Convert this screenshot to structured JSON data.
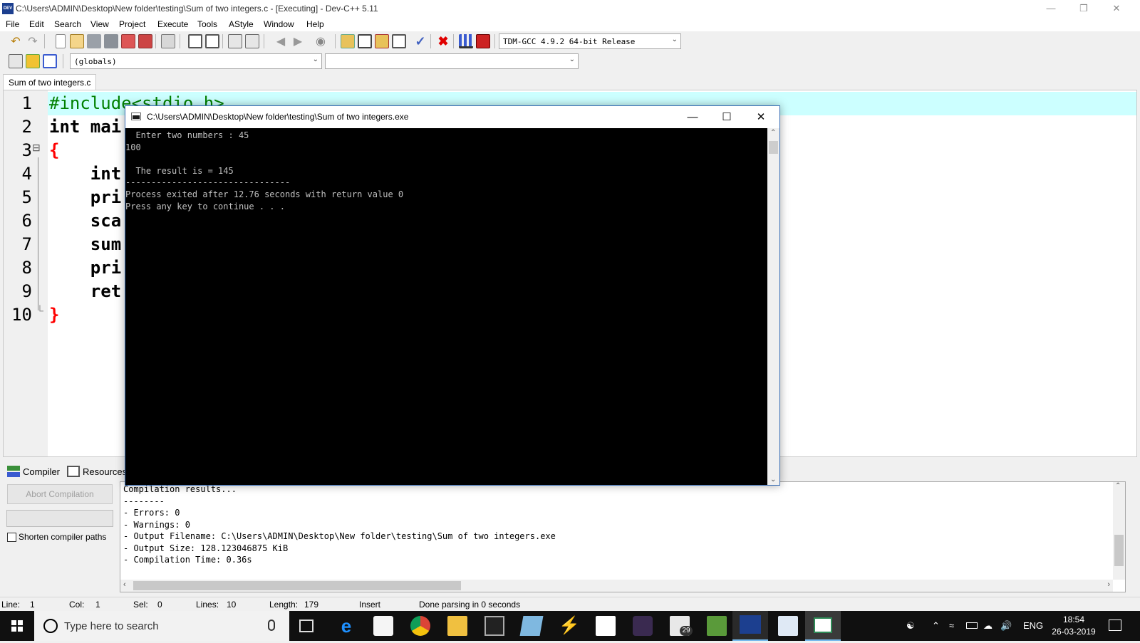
{
  "window": {
    "title": "C:\\Users\\ADMIN\\Desktop\\New folder\\testing\\Sum of two integers.c - [Executing] - Dev-C++ 5.11",
    "icon_label": "DEV"
  },
  "menu": {
    "items": [
      "File",
      "Edit",
      "Search",
      "View",
      "Project",
      "Execute",
      "Tools",
      "AStyle",
      "Window",
      "Help"
    ]
  },
  "toolbar": {
    "compiler_select": "TDM-GCC 4.9.2 64-bit Release",
    "scope_select": "(globals)",
    "member_select": ""
  },
  "editor": {
    "tab_label": "Sum of two integers.c",
    "line_numbers": [
      "1",
      "2",
      "3",
      "4",
      "5",
      "6",
      "7",
      "8",
      "9",
      "10"
    ],
    "visible_code": [
      "#include<stdio.h>",
      "int mai",
      "{",
      "    int",
      "    pri",
      "    sca",
      "    sum",
      "    pri",
      "    ret",
      "}"
    ],
    "fold_markers": [
      "⊟",
      "└"
    ]
  },
  "console": {
    "title": "C:\\Users\\ADMIN\\Desktop\\New folder\\testing\\Sum of two integers.exe",
    "lines": [
      "  Enter two numbers : 45",
      "100",
      "",
      "  The result is = 145",
      "--------------------------------",
      "Process exited after 12.76 seconds with return value 0",
      "Press any key to continue . . ."
    ]
  },
  "panel": {
    "tabs": [
      "Compiler",
      "Resources"
    ],
    "abort_button": "Abort Compilation",
    "shorten_paths_label": "Shorten compiler paths",
    "shorten_paths_checked": false,
    "log_lines": [
      "Compilation results...",
      "--------",
      "- Errors: 0",
      "- Warnings: 0",
      "- Output Filename: C:\\Users\\ADMIN\\Desktop\\New folder\\testing\\Sum of two integers.exe",
      "- Output Size: 128.123046875 KiB",
      "- Compilation Time: 0.36s"
    ]
  },
  "status": {
    "line_label": "Line:",
    "line_value": "1",
    "col_label": "Col:",
    "col_value": "1",
    "sel_label": "Sel:",
    "sel_value": "0",
    "lines_label": "Lines:",
    "lines_value": "10",
    "length_label": "Length:",
    "length_value": "179",
    "mode": "Insert",
    "message": "Done parsing in 0 seconds"
  },
  "taskbar": {
    "search_placeholder": "Type here to search",
    "mail_badge": "29",
    "language": "ENG",
    "time": "18:54",
    "date": "26-03-2019"
  },
  "colors": {
    "code_green": "#008000",
    "code_red": "#ff0000",
    "current_line": "#ccffff",
    "console_bg": "#000000",
    "console_text": "#c0c0c0",
    "taskbar_bg": "#101010"
  }
}
